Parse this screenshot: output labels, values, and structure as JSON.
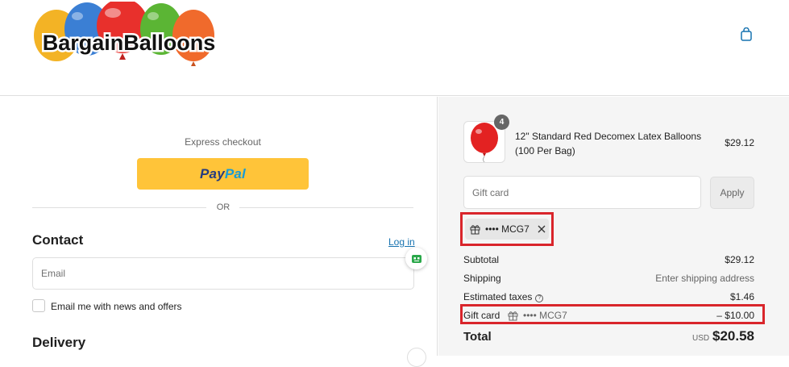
{
  "header": {
    "logo_text": "BargainBalloons",
    "cart_icon": "shopping-bag-icon"
  },
  "checkout": {
    "express_label": "Express checkout",
    "paypal": {
      "part1": "Pay",
      "part2": "Pal"
    },
    "or_label": "OR",
    "contact": {
      "title": "Contact",
      "login_label": "Log in",
      "email_placeholder": "Email",
      "newsletter_label": "Email me with news and offers"
    },
    "delivery_title": "Delivery"
  },
  "summary": {
    "item": {
      "quantity": "4",
      "name": "12\" Standard Red Decomex Latex Balloons (100 Per Bag)",
      "price": "$29.12",
      "image_icon": "red-balloon-icon"
    },
    "gift_card_placeholder": "Gift card",
    "apply_label": "Apply",
    "applied_code": "•••• MCG7",
    "rows": {
      "subtotal_label": "Subtotal",
      "subtotal_value": "$29.12",
      "shipping_label": "Shipping",
      "shipping_value": "Enter shipping address",
      "taxes_label": "Estimated taxes",
      "taxes_value": "$1.46",
      "gift_label": "Gift card",
      "gift_code": "•••• MCG7",
      "gift_value": "– $10.00"
    },
    "total": {
      "label": "Total",
      "currency": "USD",
      "value": "$20.58"
    }
  },
  "colors": {
    "paypal_yellow": "#ffc439",
    "link_blue": "#1773b0",
    "highlight_red": "#d9252b",
    "summary_bg": "#f5f5f5"
  }
}
